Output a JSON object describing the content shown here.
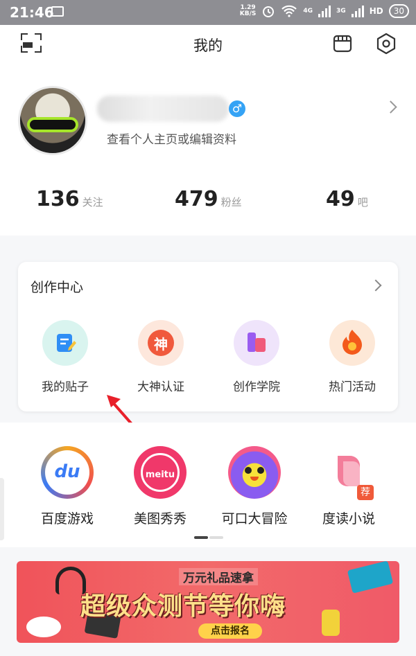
{
  "status_bar": {
    "time": "21:46",
    "net_speed": "1.29",
    "net_unit": "KB/S",
    "signal_a": "4G",
    "signal_b": "3G",
    "hd": "HD",
    "battery": "30"
  },
  "header": {
    "title": "我的"
  },
  "profile": {
    "subtitle": "查看个人主页或编辑资料",
    "gender_symbol": "♂",
    "stats": [
      {
        "value": "136",
        "label": "关注"
      },
      {
        "value": "479",
        "label": "粉丝"
      },
      {
        "value": "49",
        "label": "吧"
      }
    ]
  },
  "creation_center": {
    "title": "创作中心",
    "items": [
      {
        "label": "我的贴子",
        "icon": "edit-note-icon",
        "bg": "#d9f4ef",
        "fg": "#2f8ef5"
      },
      {
        "label": "大神认证",
        "icon": "shen-badge-icon",
        "bg": "#fde7dc",
        "fg": "#f0593c",
        "glyph": "神"
      },
      {
        "label": "创作学院",
        "icon": "academy-icon",
        "bg": "#efe4fb",
        "fg": "#9a5cf0"
      },
      {
        "label": "热门活动",
        "icon": "flame-icon",
        "bg": "#fde8d7",
        "fg": "#f35a1c"
      }
    ]
  },
  "apps": [
    {
      "label": "百度游戏",
      "icon": "baidu-game-icon",
      "text": "du"
    },
    {
      "label": "美图秀秀",
      "icon": "meitu-icon",
      "text": "meitu"
    },
    {
      "label": "可口大冒险",
      "icon": "kekou-adventure-icon"
    },
    {
      "label": "度读小说",
      "icon": "dudu-novel-icon",
      "badge": "荐"
    }
  ],
  "banner": {
    "small_text": "万元礼品速拿",
    "big_text": "超级众测节等你嗨",
    "button_text": "点击报名"
  },
  "colors": {
    "accent_blue": "#35a3f5",
    "arrow_red": "#e8202a"
  }
}
